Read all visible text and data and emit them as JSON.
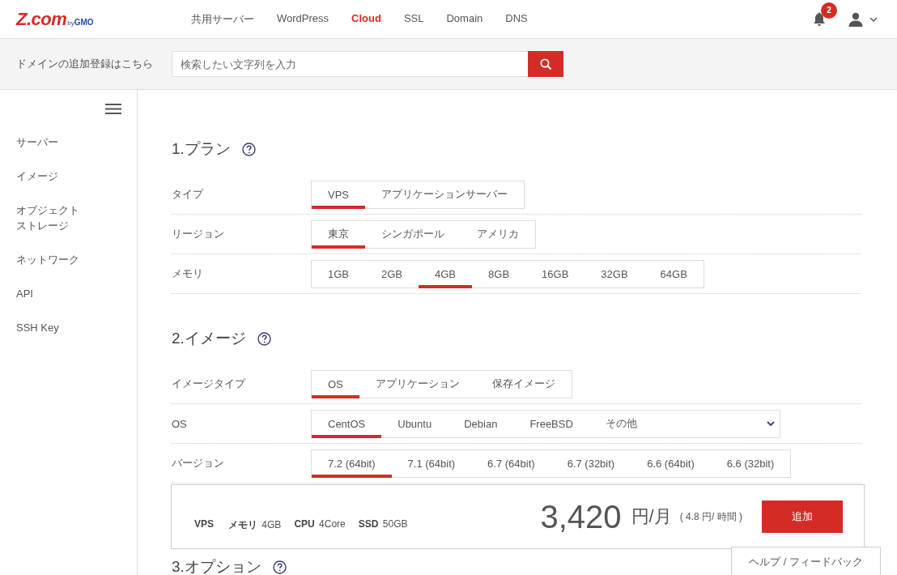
{
  "header": {
    "logo": "Z.com",
    "logo_suffix": "by",
    "logo_brand": "GMO",
    "nav": [
      {
        "label": "共用サーバー",
        "selected": false
      },
      {
        "label": "WordPress",
        "selected": false
      },
      {
        "label": "Cloud",
        "selected": true
      },
      {
        "label": "SSL",
        "selected": false
      },
      {
        "label": "Domain",
        "selected": false
      },
      {
        "label": "DNS",
        "selected": false
      }
    ],
    "notification_count": "2"
  },
  "domain_search": {
    "label": "ドメインの追加登録はこちら",
    "placeholder": "検索したい文字列を入力"
  },
  "sidebar": {
    "items": [
      {
        "label": "サーバー"
      },
      {
        "label": "イメージ"
      },
      {
        "label": "オブジェクトストレージ"
      },
      {
        "label": "ネットワーク"
      },
      {
        "label": "API"
      },
      {
        "label": "SSH Key"
      }
    ]
  },
  "sections": [
    {
      "title": "1.プラン",
      "rows": [
        {
          "kind": "segments",
          "label": "タイプ",
          "options": [
            {
              "label": "VPS",
              "selected": true
            },
            {
              "label": "アプリケーションサーバー",
              "selected": false
            }
          ]
        },
        {
          "kind": "segments",
          "label": "リージョン",
          "options": [
            {
              "label": "東京",
              "selected": true
            },
            {
              "label": "シンガポール",
              "selected": false
            },
            {
              "label": "アメリカ",
              "selected": false
            }
          ]
        },
        {
          "kind": "segments",
          "label": "メモリ",
          "options": [
            {
              "label": "1GB",
              "selected": false
            },
            {
              "label": "2GB",
              "selected": false
            },
            {
              "label": "4GB",
              "selected": true
            },
            {
              "label": "8GB",
              "selected": false
            },
            {
              "label": "16GB",
              "selected": false
            },
            {
              "label": "32GB",
              "selected": false
            },
            {
              "label": "64GB",
              "selected": false
            }
          ]
        }
      ]
    },
    {
      "title": "2.イメージ",
      "rows": [
        {
          "kind": "segments",
          "label": "イメージタイプ",
          "options": [
            {
              "label": "OS",
              "selected": true
            },
            {
              "label": "アプリケーション",
              "selected": false
            },
            {
              "label": "保存イメージ",
              "selected": false
            }
          ]
        },
        {
          "kind": "segments",
          "label": "OS",
          "dropdown": true,
          "options": [
            {
              "label": "CentOS",
              "selected": true
            },
            {
              "label": "Ubuntu",
              "selected": false
            },
            {
              "label": "Debian",
              "selected": false
            },
            {
              "label": "FreeBSD",
              "selected": false
            },
            {
              "label": "その他",
              "selected": false
            }
          ]
        },
        {
          "kind": "segments",
          "label": "バージョン",
          "options": [
            {
              "label": "7.2 (64bit)",
              "selected": true
            },
            {
              "label": "7.1 (64bit)",
              "selected": false
            },
            {
              "label": "6.7 (64bit)",
              "selected": false
            },
            {
              "label": "6.7 (32bit)",
              "selected": false
            },
            {
              "label": "6.6 (64bit)",
              "selected": false
            },
            {
              "label": "6.6 (32bit)",
              "selected": false
            }
          ]
        }
      ]
    },
    {
      "title": "3.オプション"
    }
  ],
  "summary": {
    "specs": [
      {
        "key": "VPS"
      },
      {
        "key": "メモリ",
        "value": "4GB"
      },
      {
        "key": "CPU",
        "value": "4Core"
      },
      {
        "key": "SSD",
        "value": "50GB"
      }
    ],
    "price": "3,420",
    "unit": "円/月",
    "hourly": "( 4.8 円/ 時間 )",
    "button": "追加"
  },
  "help_button": "ヘルプ / フィードバック"
}
